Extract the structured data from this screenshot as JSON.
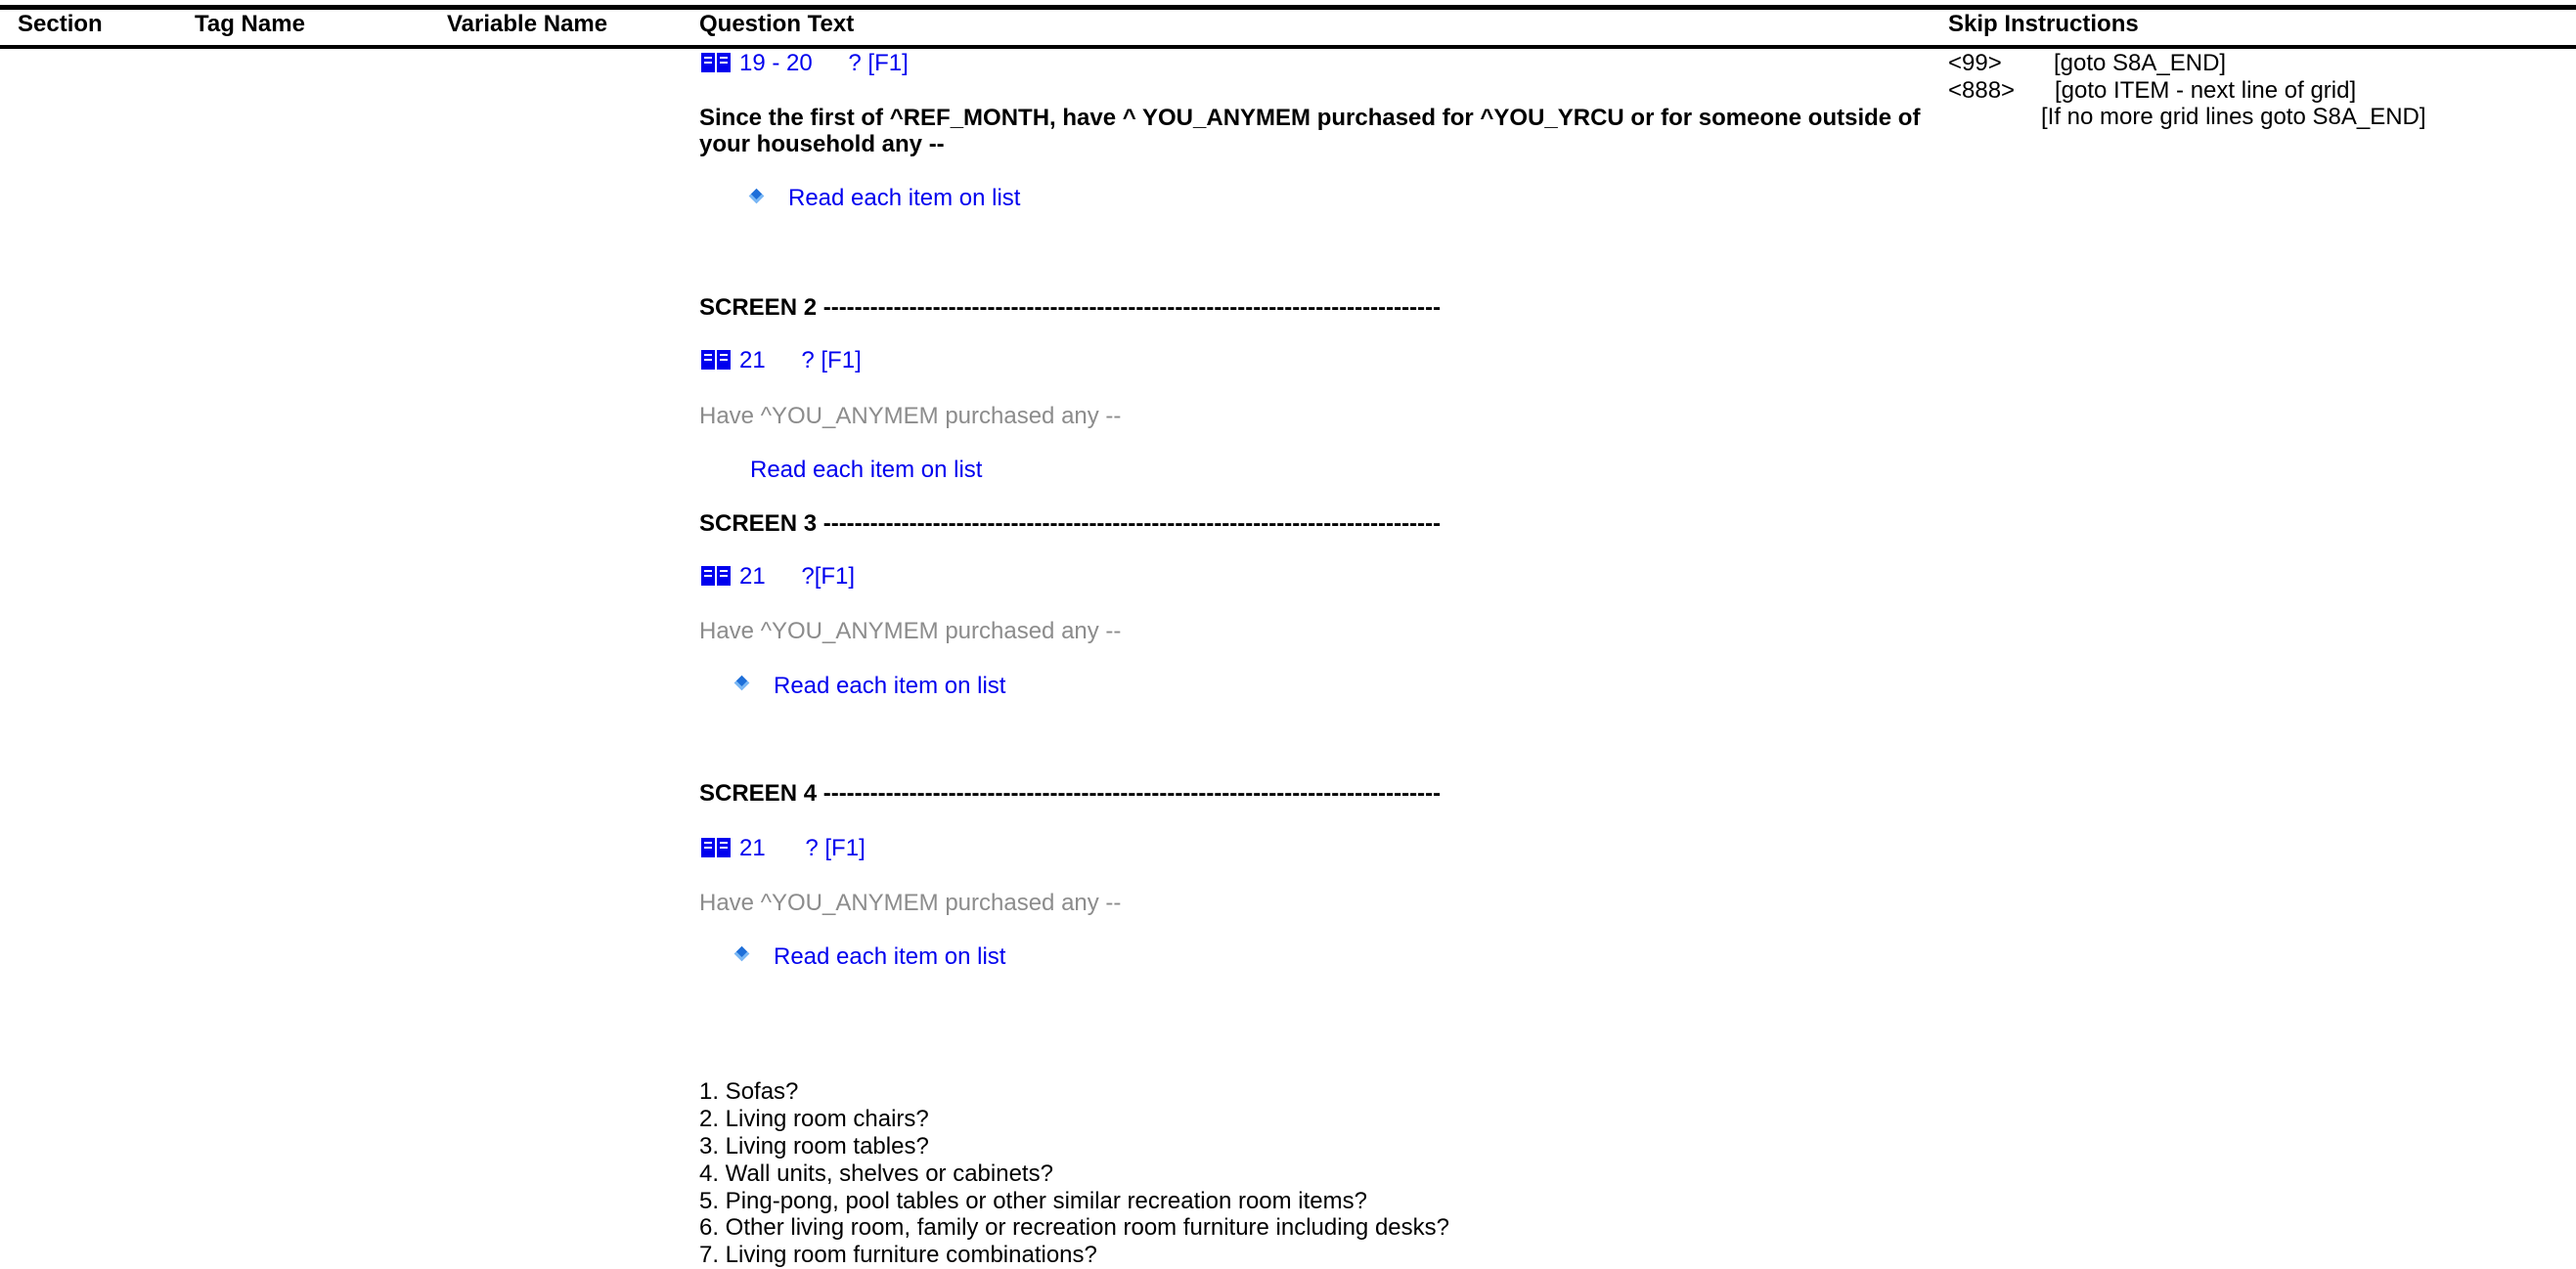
{
  "header": {
    "section": "Section",
    "tag_name": "Tag Name",
    "variable_name": "Variable Name",
    "question_text": "Question Text",
    "skip_instructions": "Skip Instructions"
  },
  "screen1": {
    "ref": "19 - 20",
    "help": "? [F1]",
    "question_line1": "Since the first of ^REF_MONTH, have ^ YOU_ANYMEM purchased for ^YOU_YRCU or for someone outside of",
    "question_line2": "your household any --",
    "instruction": "Read each item on list"
  },
  "screen2": {
    "heading": "SCREEN 2 -------------------------------------------------------------------------------",
    "ref": "21",
    "help": "? [F1]",
    "question": "Have ^YOU_ANYMEM purchased any --",
    "instruction": "Read each item on list"
  },
  "screen3": {
    "heading": "SCREEN 3 -------------------------------------------------------------------------------",
    "ref": "21",
    "help": "?[F1]",
    "question": "Have ^YOU_ANYMEM purchased any --",
    "instruction": "Read each item on list"
  },
  "screen4": {
    "heading": "SCREEN 4 -------------------------------------------------------------------------------",
    "ref": "21",
    "help": "? [F1]",
    "question": "Have ^YOU_ANYMEM purchased any --",
    "instruction": "Read each item on list"
  },
  "items": [
    "1. Sofas?",
    "2. Living room chairs?",
    "3. Living room tables?",
    "4. Wall units, shelves or cabinets?",
    "5. Ping-pong, pool tables or other similar recreation room items?",
    "6. Other living room, family or recreation room furniture including desks?",
    "7. Living room furniture combinations?"
  ],
  "skip": {
    "code1": "<99>",
    "instr1": "[goto S8A_END]",
    "code2": "<888>",
    "instr2": "[goto ITEM - next line of grid]",
    "instr3": "[If no more grid lines goto S8A_END]"
  },
  "colors": {
    "link_blue": "#0000ee",
    "muted_gray": "#8c8c8c",
    "bullet_blue": "#1e6fd9"
  },
  "icons": {
    "reference": "book-icon",
    "bullet": "diamond-bullet-icon"
  }
}
